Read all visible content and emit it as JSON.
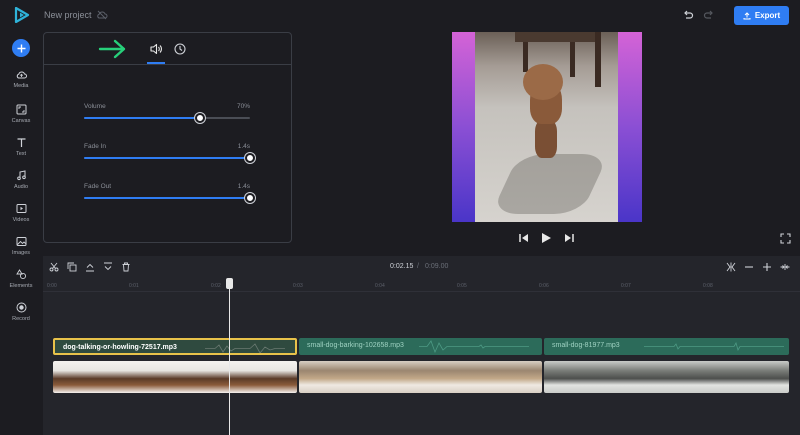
{
  "header": {
    "project_name": "New project",
    "export_label": "Export"
  },
  "sidebar": {
    "items": [
      {
        "label": "Media",
        "icon": "cloud-upload-icon"
      },
      {
        "label": "Canvas",
        "icon": "canvas-icon"
      },
      {
        "label": "Text",
        "icon": "text-icon"
      },
      {
        "label": "Audio",
        "icon": "music-note-icon"
      },
      {
        "label": "Videos",
        "icon": "video-icon"
      },
      {
        "label": "Images",
        "icon": "image-icon"
      },
      {
        "label": "Elements",
        "icon": "shapes-icon"
      },
      {
        "label": "Record",
        "icon": "record-icon"
      }
    ]
  },
  "audio_panel": {
    "tabs": [
      {
        "name": "audio",
        "icon": "speaker-icon",
        "active": true
      },
      {
        "name": "speed",
        "icon": "clock-icon",
        "active": false
      }
    ],
    "volume": {
      "label": "Volume",
      "value_text": "70%",
      "value": 0.7
    },
    "fade_in": {
      "label": "Fade In",
      "value_text": "1.4s",
      "value": 1.0
    },
    "fade_out": {
      "label": "Fade Out",
      "value_text": "1.4s",
      "value": 1.0
    }
  },
  "timeline": {
    "current_time": "0:02.15",
    "separator": "/",
    "total_time": "0:09.00",
    "ticks": [
      "0:00",
      "0:01",
      "0:02",
      "0:03",
      "0:04",
      "0:05",
      "0:06",
      "0:07",
      "0:08"
    ],
    "audio_clips": [
      {
        "name": "dog-talking-or-howling-72517.mp3",
        "selected": true
      },
      {
        "name": "small-dog-barking-102658.mp3",
        "selected": false
      },
      {
        "name": "small-dog-81977.mp3",
        "selected": false
      }
    ]
  },
  "colors": {
    "accent": "#2f7df3",
    "audio_clip": "#2c6b5a",
    "selection": "#e8c24a",
    "arrow": "#27d07a"
  }
}
